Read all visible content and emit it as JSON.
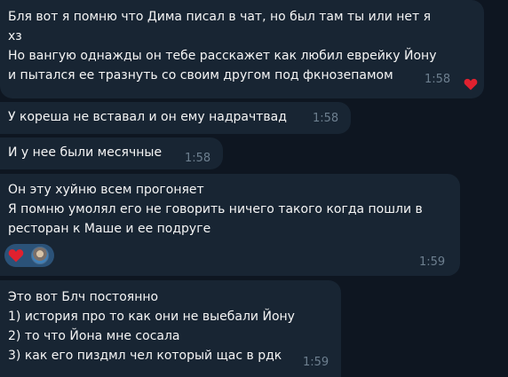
{
  "messages": [
    {
      "lines": [
        "Бля вот я помню что Дима писал в чат, но был там ты или нет я",
        "хз",
        "Но вангую однажды он тебе расскажет как любил еврейку Йону",
        "и пытался ее тразнуть со своим другом под фкнозепамом"
      ],
      "time": "1:58",
      "reaction_icon": "heart-icon"
    },
    {
      "lines": [
        "У кореша не вставал и он ему надрачтвад"
      ],
      "time": "1:58"
    },
    {
      "lines": [
        "И у нее были месячные"
      ],
      "time": "1:58"
    },
    {
      "lines": [
        "Он эту хуйню всем прогоняет",
        "Я помню умолял его не говорить ничего такого когда пошли в",
        "ресторан к Маше и ее подруге"
      ],
      "time": "1:59",
      "reactions": [
        "heart-icon",
        "avatar"
      ]
    },
    {
      "lines": [
        "Это вот Блч постоянно",
        "1) история про то как они не выебали Йону",
        "2) то что Йона мне сосала",
        "3) как его пиздмл чел который щас в рдк"
      ],
      "time": "1:59"
    }
  ],
  "colors": {
    "background": "#0e1621",
    "bubble": "#182533",
    "text": "#f5f5f5",
    "time": "#6d7f8f",
    "heart": "#e0212f",
    "reaction_pill": "#2b5278"
  }
}
